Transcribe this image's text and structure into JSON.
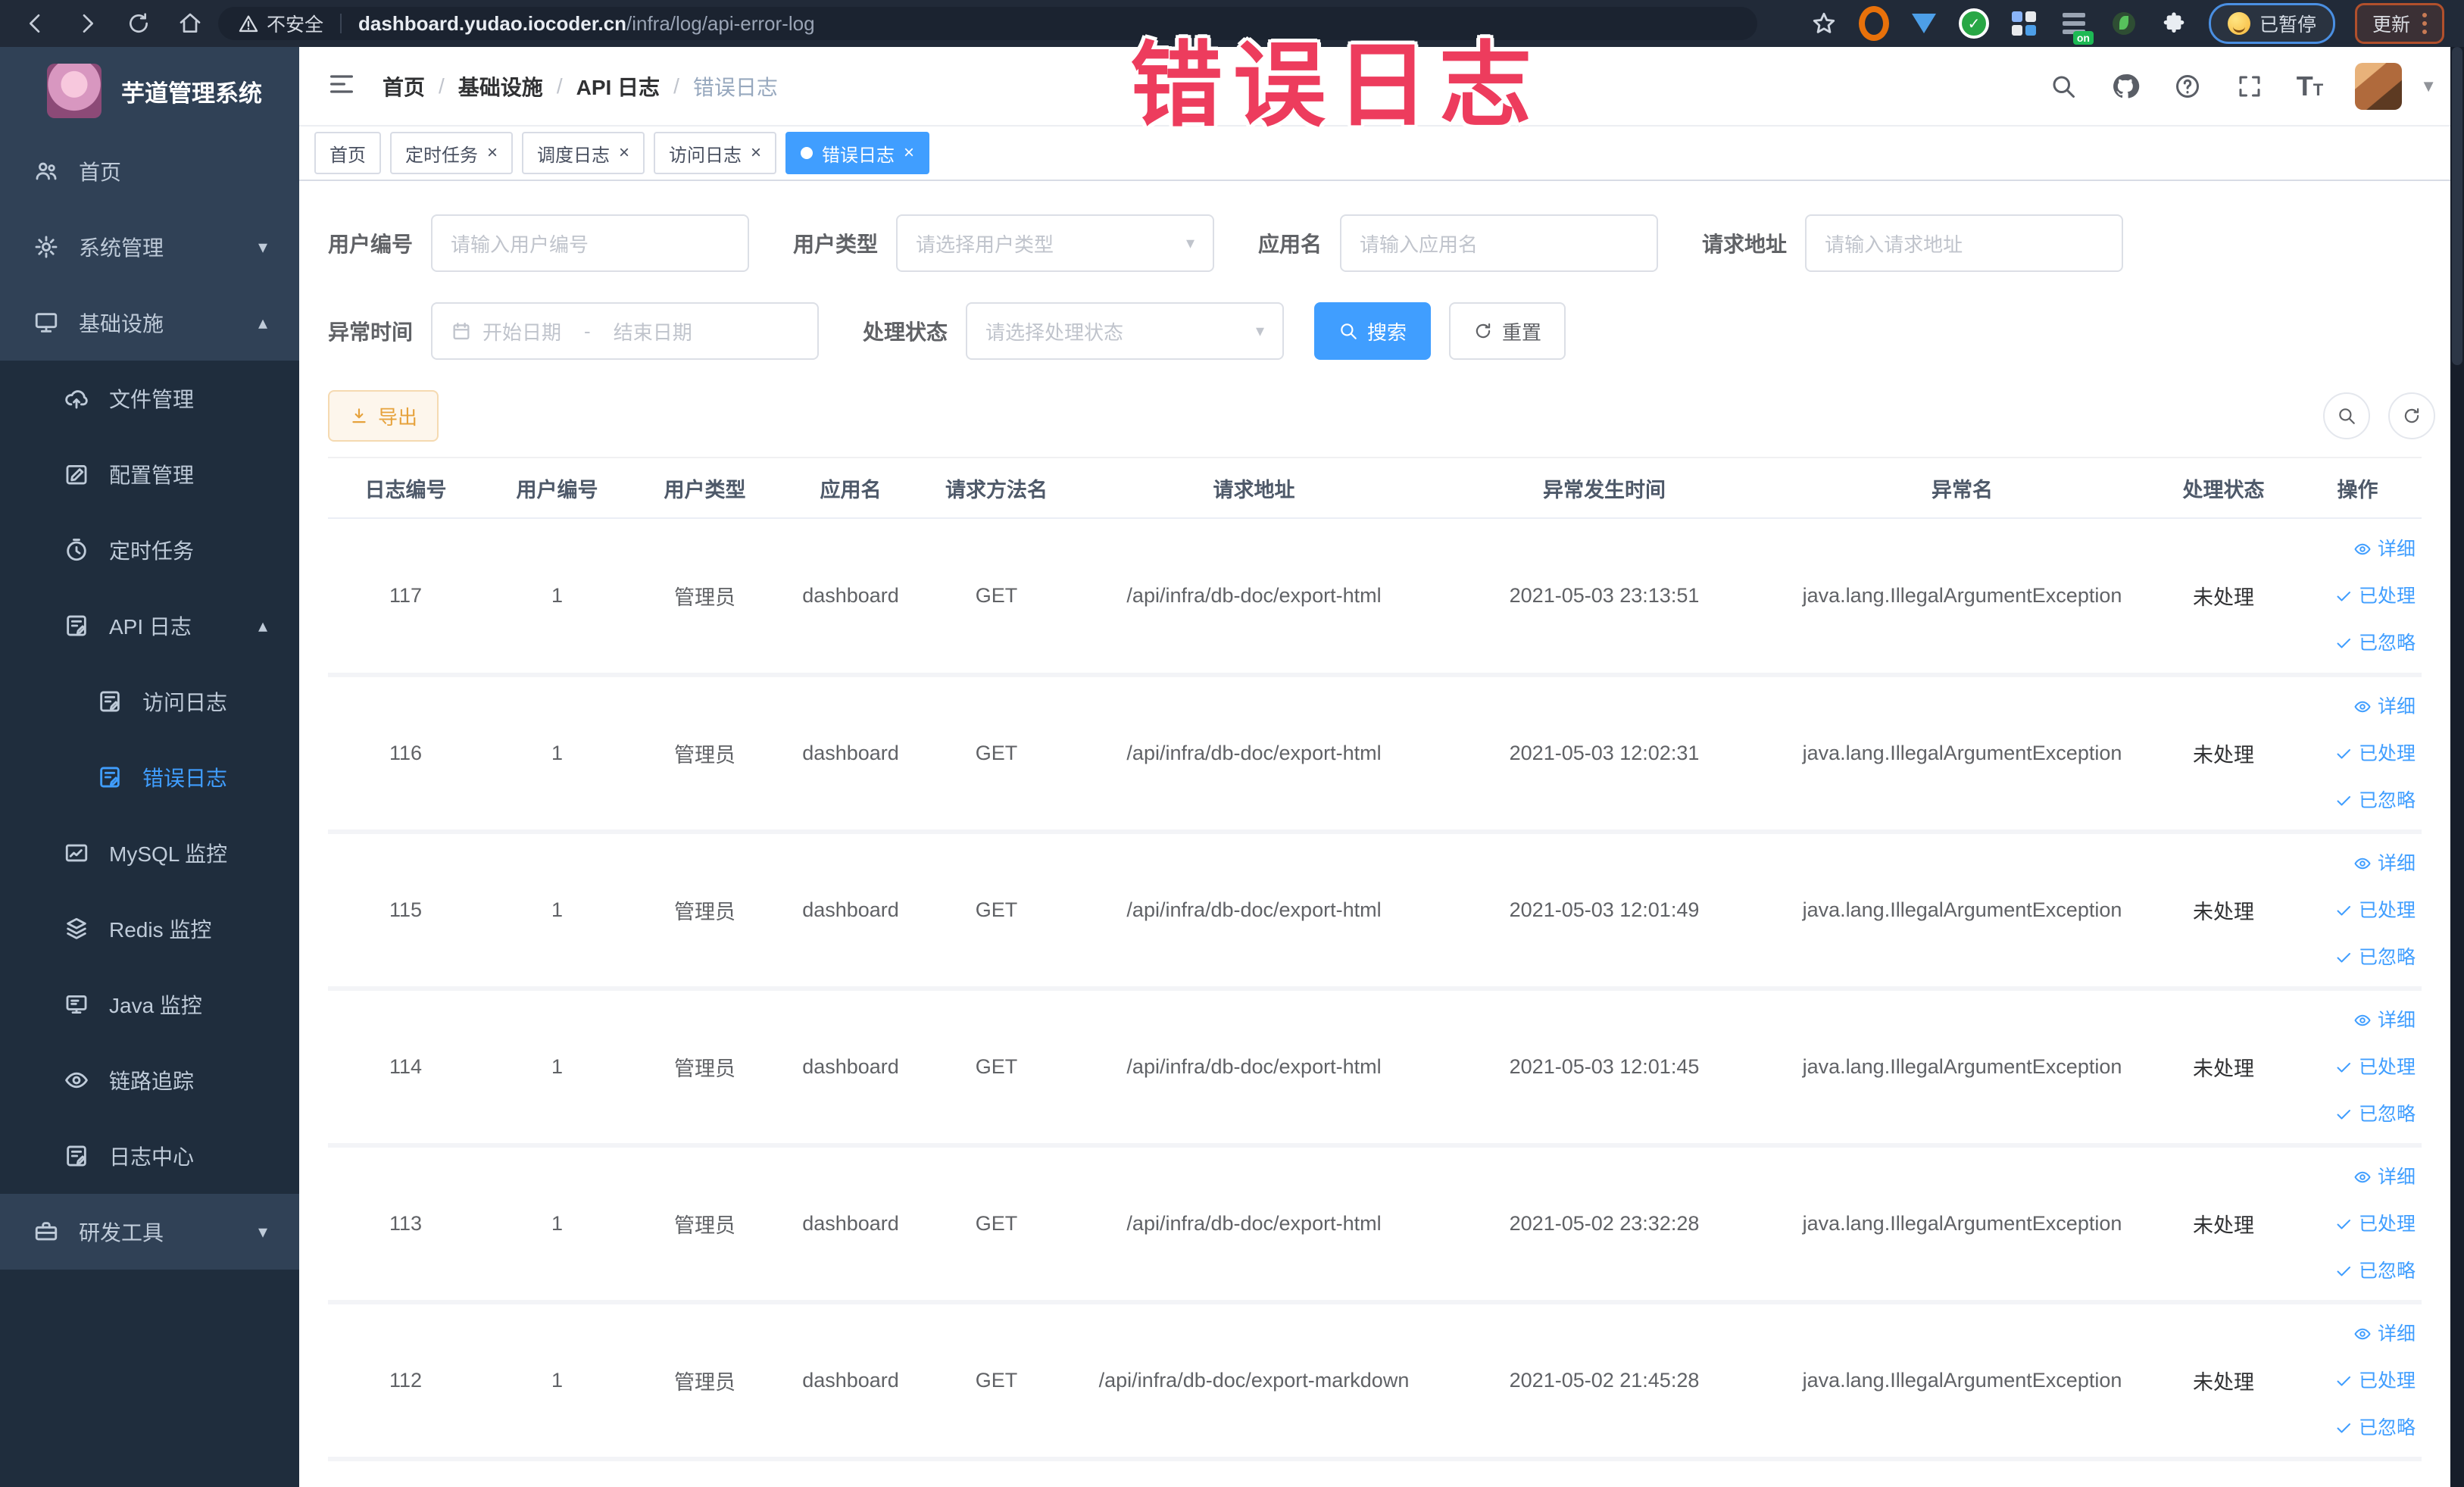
{
  "browser": {
    "security_label": "不安全",
    "url_host": "dashboard.yudao.iocoder.cn",
    "url_path": "/infra/log/api-error-log",
    "extension_badge": "on",
    "paused_badge": "已暂停",
    "update_button": "更新"
  },
  "overlay": {
    "text": "错误日志",
    "color": "#ed3c5d"
  },
  "sidebar": {
    "title": "芋道管理系统",
    "items": [
      {
        "label": "首页"
      },
      {
        "label": "系统管理"
      },
      {
        "label": "基础设施"
      },
      {
        "label": "文件管理"
      },
      {
        "label": "配置管理"
      },
      {
        "label": "定时任务"
      },
      {
        "label": "API 日志"
      },
      {
        "label": "访问日志"
      },
      {
        "label": "错误日志"
      },
      {
        "label": "MySQL 监控"
      },
      {
        "label": "Redis 监控"
      },
      {
        "label": "Java 监控"
      },
      {
        "label": "链路追踪"
      },
      {
        "label": "日志中心"
      },
      {
        "label": "研发工具"
      }
    ]
  },
  "navbar": {
    "breadcrumb": [
      "首页",
      "基础设施",
      "API 日志",
      "错误日志"
    ]
  },
  "tabs": [
    {
      "label": "首页"
    },
    {
      "label": "定时任务"
    },
    {
      "label": "调度日志"
    },
    {
      "label": "访问日志"
    },
    {
      "label": "错误日志"
    }
  ],
  "filters": {
    "user_id": {
      "label": "用户编号",
      "placeholder": "请输入用户编号"
    },
    "user_type": {
      "label": "用户类型",
      "placeholder": "请选择用户类型"
    },
    "app_name": {
      "label": "应用名",
      "placeholder": "请输入应用名"
    },
    "request_url": {
      "label": "请求地址",
      "placeholder": "请输入请求地址"
    },
    "exception_time": {
      "label": "异常时间",
      "start_placeholder": "开始日期",
      "separator": "-",
      "end_placeholder": "结束日期"
    },
    "process_status": {
      "label": "处理状态",
      "placeholder": "请选择处理状态"
    },
    "search_button": "搜索",
    "reset_button": "重置"
  },
  "toolbar": {
    "export_button": "导出"
  },
  "table": {
    "headers": [
      "日志编号",
      "用户编号",
      "用户类型",
      "应用名",
      "请求方法名",
      "请求地址",
      "异常发生时间",
      "异常名",
      "处理状态",
      "操作"
    ],
    "action_labels": [
      "详细",
      "已处理",
      "已忽略"
    ],
    "rows": [
      {
        "id": "117",
        "user_id": "1",
        "user_type": "管理员",
        "app": "dashboard",
        "method": "GET",
        "url": "/api/infra/db-doc/export-html",
        "time": "2021-05-03 23:13:51",
        "exception": "java.lang.IllegalArgumentException",
        "status": "未处理"
      },
      {
        "id": "116",
        "user_id": "1",
        "user_type": "管理员",
        "app": "dashboard",
        "method": "GET",
        "url": "/api/infra/db-doc/export-html",
        "time": "2021-05-03 12:02:31",
        "exception": "java.lang.IllegalArgumentException",
        "status": "未处理"
      },
      {
        "id": "115",
        "user_id": "1",
        "user_type": "管理员",
        "app": "dashboard",
        "method": "GET",
        "url": "/api/infra/db-doc/export-html",
        "time": "2021-05-03 12:01:49",
        "exception": "java.lang.IllegalArgumentException",
        "status": "未处理"
      },
      {
        "id": "114",
        "user_id": "1",
        "user_type": "管理员",
        "app": "dashboard",
        "method": "GET",
        "url": "/api/infra/db-doc/export-html",
        "time": "2021-05-03 12:01:45",
        "exception": "java.lang.IllegalArgumentException",
        "status": "未处理"
      },
      {
        "id": "113",
        "user_id": "1",
        "user_type": "管理员",
        "app": "dashboard",
        "method": "GET",
        "url": "/api/infra/db-doc/export-html",
        "time": "2021-05-02 23:32:28",
        "exception": "java.lang.IllegalArgumentException",
        "status": "未处理"
      },
      {
        "id": "112",
        "user_id": "1",
        "user_type": "管理员",
        "app": "dashboard",
        "method": "GET",
        "url": "/api/infra/db-doc/export-markdown",
        "time": "2021-05-02 21:45:28",
        "exception": "java.lang.IllegalArgumentException",
        "status": "未处理"
      }
    ]
  },
  "colors": {
    "accent": "#409eff",
    "warning": "#e6a23c",
    "sidebar_bg": "#304156",
    "submenu_bg": "#1f2d3d",
    "overlay_red": "#ed3c5d",
    "tag_active": "#409eff"
  }
}
